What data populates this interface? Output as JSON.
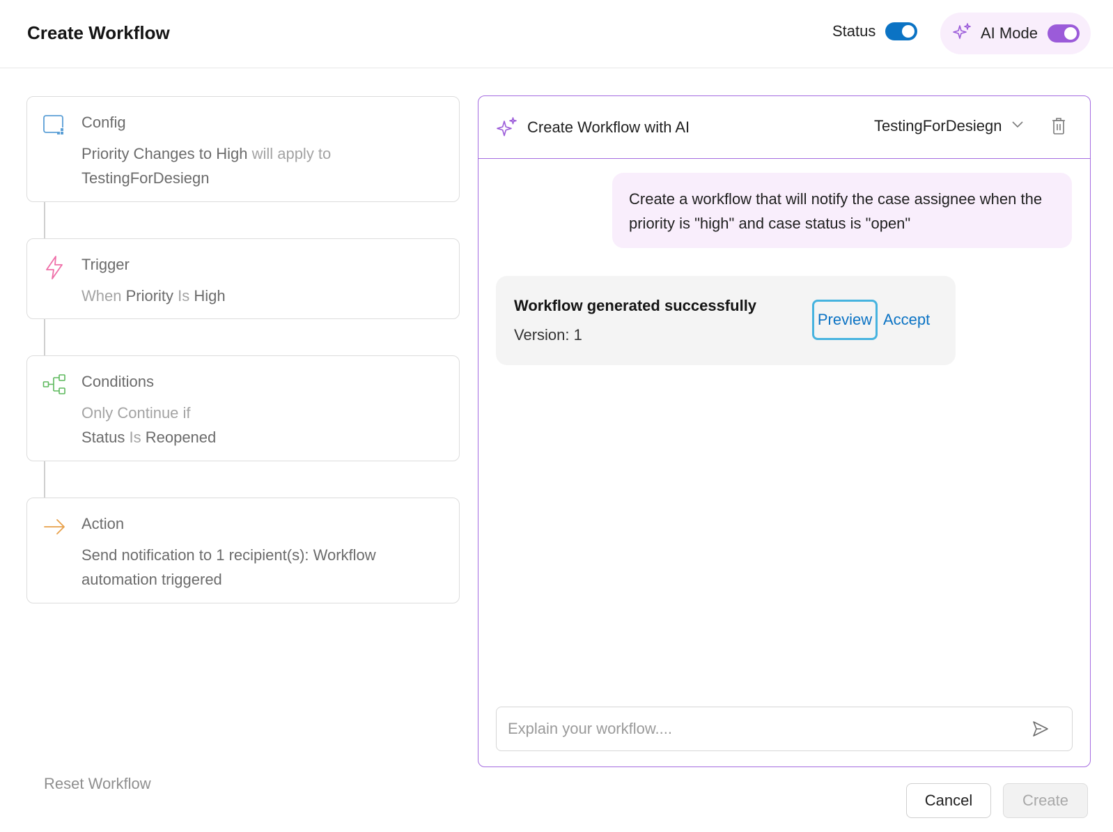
{
  "header": {
    "title": "Create Workflow",
    "status_label": "Status",
    "status_on": true,
    "ai_mode_label": "AI Mode",
    "ai_mode_on": true
  },
  "steps": [
    {
      "title": "Config",
      "icon": "config-icon",
      "body": [
        {
          "text": "Priority Changes to High",
          "muted": false
        },
        {
          "text": " will apply to ",
          "muted": true
        },
        {
          "text": "TestingForDesiegn",
          "muted": false
        }
      ]
    },
    {
      "title": "Trigger",
      "icon": "lightning-icon",
      "body": [
        {
          "text": "When ",
          "muted": true
        },
        {
          "text": "Priority",
          "muted": false
        },
        {
          "text": " Is ",
          "muted": true
        },
        {
          "text": "High",
          "muted": false
        }
      ]
    },
    {
      "title": "Conditions",
      "icon": "branch-icon",
      "body": [
        {
          "text": "Only Continue if",
          "muted": true
        },
        {
          "text": "Status",
          "muted": false
        },
        {
          "text": " Is ",
          "muted": true
        },
        {
          "text": "Reopened",
          "muted": false
        }
      ]
    },
    {
      "title": "Action",
      "icon": "arrow-right-icon",
      "body": [
        {
          "text": "Send notification to 1 recipient(s): Workflow automation triggered",
          "muted": false
        }
      ]
    }
  ],
  "ai_panel": {
    "title": "Create Workflow with AI",
    "selected_project": "TestingForDesiegn",
    "user_message": "Create a workflow that will notify the case assignee when the priority is \"high\" and case status is \"open\"",
    "ai_message": {
      "title": "Workflow generated successfully",
      "version": "Version: 1",
      "preview_label": "Preview",
      "accept_label": "Accept"
    },
    "input_placeholder": "Explain your workflow...."
  },
  "footer": {
    "reset_label": "Reset Workflow",
    "cancel_label": "Cancel",
    "create_label": "Create"
  },
  "colors": {
    "accent_blue": "#0b73c4",
    "accent_purple": "#9b5bd9",
    "panel_border": "#a46be0",
    "pill_bg": "#f9eefc",
    "config_icon": "#5b9fd6",
    "trigger_icon": "#ef6fa8",
    "conditions_icon": "#5cb85c",
    "action_icon": "#e8a04a"
  }
}
